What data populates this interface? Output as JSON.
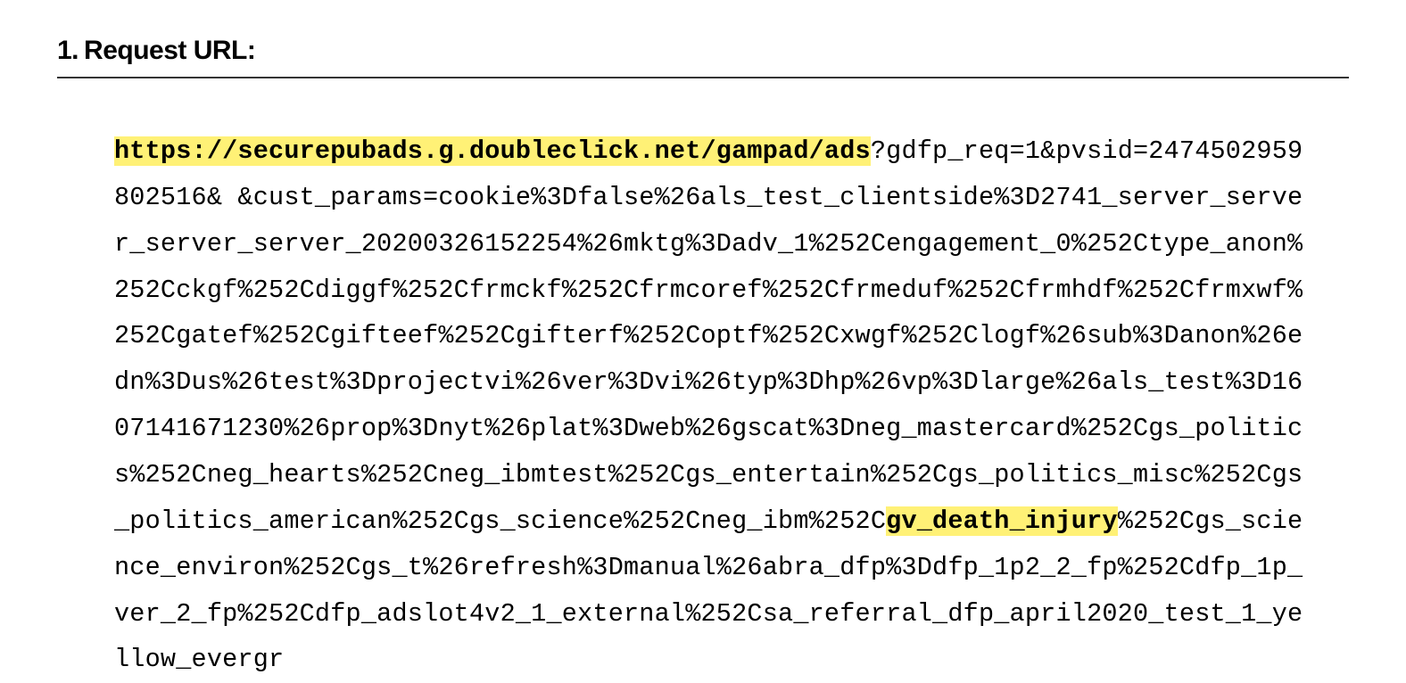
{
  "heading": {
    "number": "1.",
    "title": "Request URL:"
  },
  "url": {
    "host_path": "https://securepubads.g.doubleclick.net/gampad/ads",
    "segment_before_highlight2": "?gdfp_req=1&pvsid=247450295980251​6& &cust_params=cookie%3Dfalse%26als_test_clientside%3D2741_server_server_server_server_20200326152254%26mktg%3Dadv_1%252Cengagement_0%252Ctype_anon%252Cckgf%252Cdiggf%252Cfrmckf%252Cfrmcoref%252Cfrmeduf%252Cfrmhdf%252Cfrmxwf%252Cgatef%252Cgifteef%252Cgifterf%252Coptf%252Cxwgf%252Clogf%26sub%3Danon%26edn%3Dus%26test%3Dprojectvi%26ver%3Dvi%26typ%3Dhp%26vp%3Dlarge%26als_test%3D1607141671230%26prop%3Dnyt%26plat%3Dweb%26gscat%3Dneg_mastercard%252Cgs_politics%252Cneg_hearts%252Cneg_ibmtest%252Cgs_entertain%252Cgs_politics_misc%252Cgs_politics_american%252Cgs_science%252Cneg_ibm%252C",
    "highlight2": "gv_death_injury",
    "segment_after_highlight2": "%252Cgs_science_environ%252Cgs_t%26refresh%3Dmanual%26abra_dfp%3Ddfp_1p2_2_fp%252Cdfp_1p_ver_2_fp%252Cdfp_adslot4v2_1_external%252Csa_referral_dfp_april2020_test_1_yellow_evergr"
  }
}
